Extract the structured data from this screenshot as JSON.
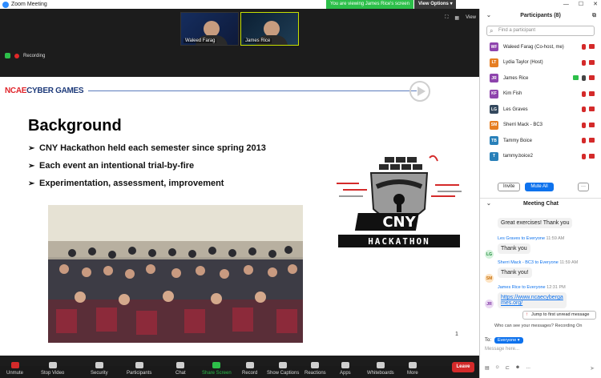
{
  "titlebar": {
    "app_title": "Zoom Meeting",
    "viewing_banner": "You are viewing James Rice's screen",
    "view_options": "View Options",
    "window_controls": [
      "—",
      "☐",
      "✕"
    ]
  },
  "status": {
    "recording": "Recording"
  },
  "video_thumbs": [
    {
      "name": "Waleed Farag"
    },
    {
      "name": "James Rice"
    }
  ],
  "view": {
    "label": "View"
  },
  "slide": {
    "brand_prefix": "NCAE",
    "brand_suffix": "CYBER GAMES",
    "title": "Background",
    "bullets": [
      "CNY Hackathon held each semester since spring 2013",
      "Each event an intentional trial-by-fire",
      "Experimentation, assessment, improvement"
    ],
    "bullet_marker": "➢",
    "logo_line1": "CNY",
    "logo_line2": "HACKATHON",
    "page_number": "1"
  },
  "toolbar": {
    "items": [
      {
        "label": "Unmute",
        "icon": "mic-off-icon"
      },
      {
        "label": "Stop Video",
        "icon": "video-icon"
      },
      {
        "label": "Security",
        "icon": "shield-icon"
      },
      {
        "label": "Participants",
        "icon": "people-icon",
        "count": "8"
      },
      {
        "label": "Chat",
        "icon": "chat-icon"
      },
      {
        "label": "Share Screen",
        "icon": "share-screen-icon"
      },
      {
        "label": "Record",
        "icon": "record-icon"
      },
      {
        "label": "Show Captions",
        "icon": "cc-icon"
      },
      {
        "label": "Reactions",
        "icon": "reaction-icon"
      },
      {
        "label": "Apps",
        "icon": "apps-icon"
      },
      {
        "label": "Whiteboards",
        "icon": "whiteboard-icon"
      },
      {
        "label": "More",
        "icon": "more-icon"
      }
    ],
    "leave": "Leave"
  },
  "participants_panel": {
    "title": "Participants (8)",
    "search_placeholder": "Find a participant",
    "participants": [
      {
        "initials": "WF",
        "name": "Waleed Farag (Co-host, me)",
        "color": "#8e44ad"
      },
      {
        "initials": "LT",
        "name": "Lydia Taylor (Host)",
        "color": "#e67e22"
      },
      {
        "initials": "JR",
        "name": "James Rice",
        "color": "#8e44ad"
      },
      {
        "initials": "KF",
        "name": "Kim Fish",
        "color": "#8e44ad"
      },
      {
        "initials": "LG",
        "name": "Les Graves",
        "color": "#34495e"
      },
      {
        "initials": "SM",
        "name": "Sherri Mack - BC3",
        "color": "#e67e22"
      },
      {
        "initials": "TB",
        "name": "Tammy Boice",
        "color": "#2980b9"
      },
      {
        "initials": "T",
        "name": "tammy.boice2",
        "color": "#2980b9"
      }
    ],
    "invite": "Invite",
    "mute_all": "Mute All",
    "more": "···"
  },
  "chat_panel": {
    "title": "Meeting Chat",
    "messages": [
      {
        "text": "Great exercises! Thank you"
      },
      {
        "sender": "Les Graves",
        "to": "to Everyone",
        "time": "11:59 AM",
        "initials": "LG",
        "text": "Thank you"
      },
      {
        "sender": "Sherri Mack - BC3",
        "to": "to Everyone",
        "time": "11:59 AM",
        "initials": "SM",
        "text": "Thank you!"
      },
      {
        "sender": "James Rice",
        "to": "to Everyone",
        "time": "12:31 PM",
        "initials": "JR",
        "text": "https://www.ncaecybergames.org/"
      }
    ],
    "jump_unread": "Jump to first unread message",
    "who_can_see": "Who can see your messages? Recording On",
    "to_label": "To:",
    "to_value": "Everyone",
    "message_placeholder": "Message here...",
    "format_icons": [
      "file-icon",
      "emoji-icon",
      "cc-icon",
      "emoji2-icon",
      "more-icon"
    ]
  },
  "colors": {
    "accent": "#0e72ed",
    "green": "#2dbf4a",
    "red": "#d42a2a",
    "brand_blue": "#1d3a7a"
  }
}
